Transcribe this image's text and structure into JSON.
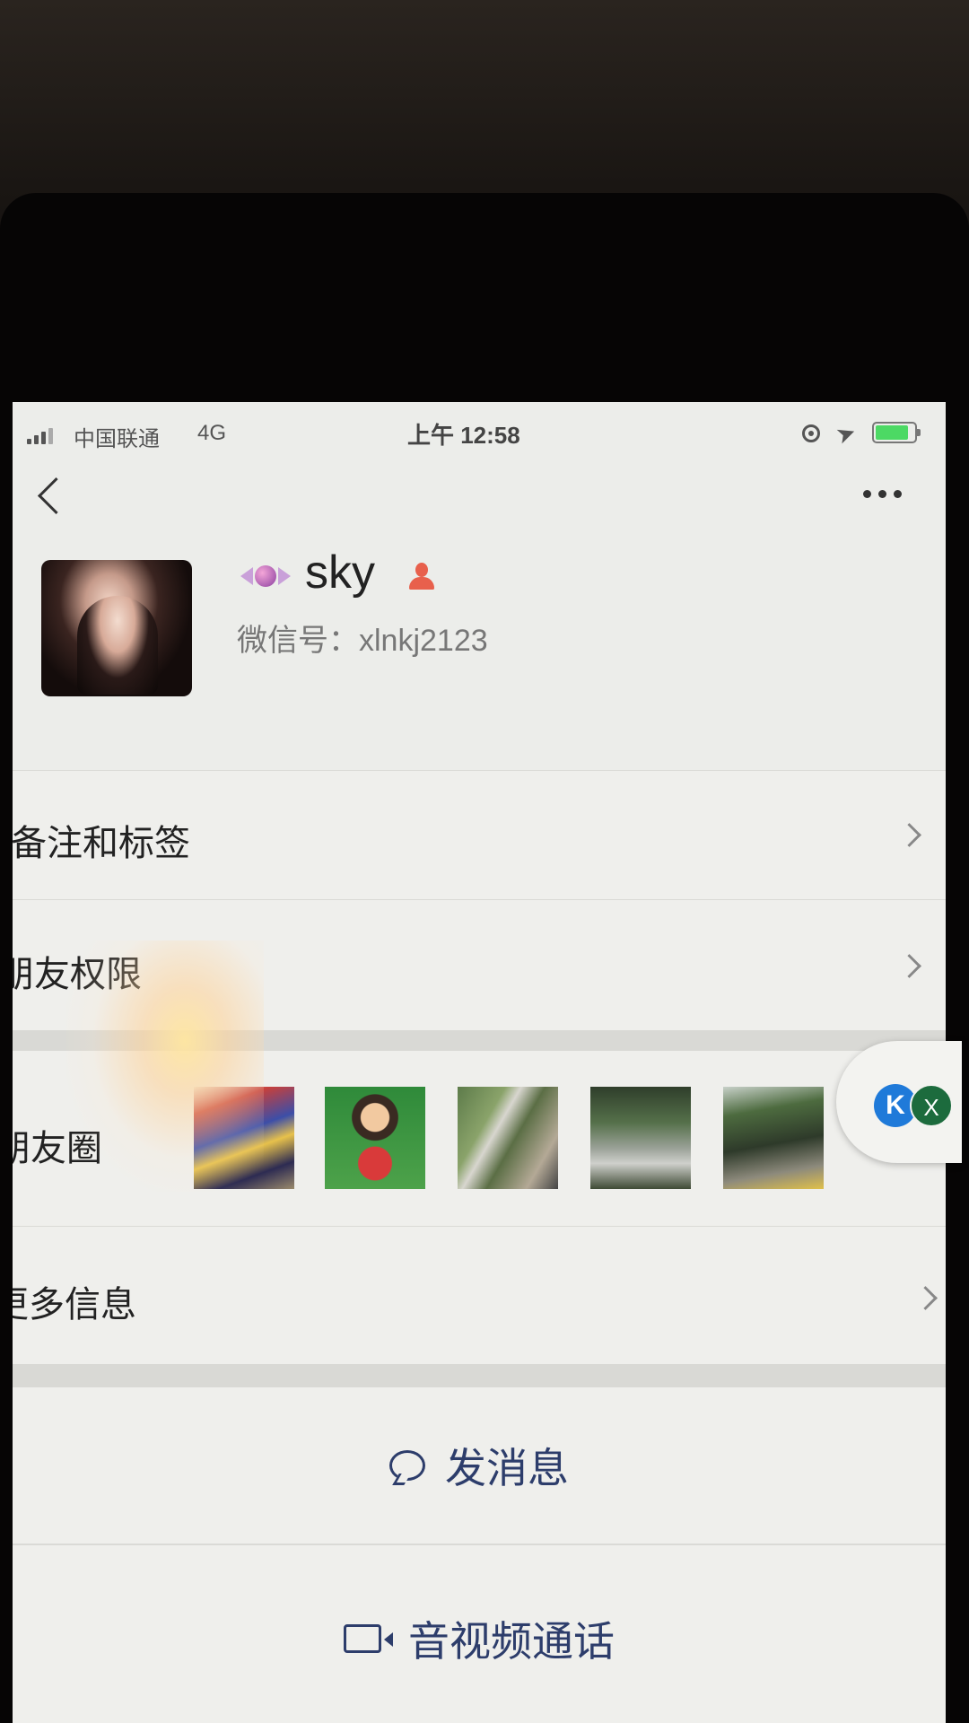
{
  "status_bar": {
    "carrier": "中国联通",
    "network": "4G",
    "time": "上午 12:58",
    "battery_color": "#4cd964",
    "battery_level": 0.8
  },
  "nav": {
    "back_icon": "chevron-left-icon",
    "more_icon": "more-dots-icon"
  },
  "profile": {
    "name": "sky",
    "wechat_id": "微信号：xlnkj2123",
    "name_emoji_icon": "candy-icon",
    "gender_icon": "female-icon",
    "gender_color": "#e8604c"
  },
  "rows": {
    "remark": "备注和标签",
    "permissions": "朋友权限",
    "moments": "朋友圈",
    "more_info": "更多信息"
  },
  "floating_widget": {
    "left_icon_letter": "K",
    "right_icon_letter": "X"
  },
  "actions": {
    "message": "发消息",
    "call": "音视频通话",
    "accent_color": "#2d3d6b"
  }
}
